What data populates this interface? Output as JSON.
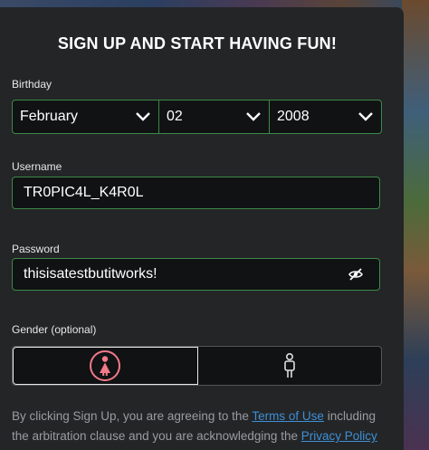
{
  "form": {
    "title": "SIGN UP AND START HAVING FUN!",
    "birthday": {
      "label": "Birthday",
      "month": "February",
      "day": "02",
      "year": "2008"
    },
    "username": {
      "label": "Username",
      "value": "TR0PIC4L_K4R0L"
    },
    "password": {
      "label": "Password",
      "value": "thisisatestbutitworks!"
    },
    "gender": {
      "label": "Gender (optional)",
      "selected": "female"
    },
    "disclaimer": {
      "text_before": "By clicking Sign Up, you are agreeing to the ",
      "terms_link": "Terms of Use",
      "text_middle": " including the arbitration clause and you are acknowledging the ",
      "privacy_link": "Privacy Policy"
    }
  },
  "colors": {
    "card_bg": "#232527",
    "field_bg": "#111214",
    "field_border": "#3c8a48",
    "link": "#3f8fd6",
    "female_icon": "#f27a8a"
  }
}
